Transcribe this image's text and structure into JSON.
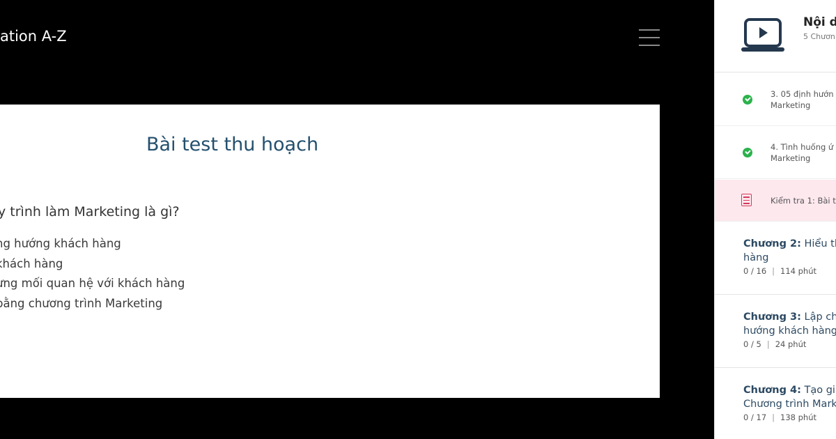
{
  "header": {
    "course_title": "ation A-Z"
  },
  "quiz": {
    "title": "Bài test thu hoạch",
    "question": "y trình làm Marketing là gì?",
    "answers": [
      "ng hướng khách hàng",
      " khách hàng",
      "ựng mối quan hệ với khách hàng",
      " bằng chương trình Marketing"
    ]
  },
  "sidebar": {
    "title": "Nội du",
    "subtitle": "5 Chươn",
    "lessons": [
      {
        "line1": "3. 05 định hướn",
        "line2": "Marketing",
        "status": "completed"
      },
      {
        "line1": "4. Tình huống ứ",
        "line2": "Marketing",
        "status": "completed"
      }
    ],
    "active_item": {
      "label": "Kiểm tra 1: Bài t"
    },
    "chapters": [
      {
        "prefix": "Chương 2:",
        "name": " Hiểu thị",
        "line2": "hàng",
        "progress": "0 / 16",
        "duration": "114 phút"
      },
      {
        "prefix": "Chương 3:",
        "name": " Lập chiế",
        "line2": "hướng khách hàng",
        "progress": "0 / 5",
        "duration": "24 phút"
      },
      {
        "prefix": "Chương 4:",
        "name": " Tạo giá ",
        "line2": "Chương trình Mark",
        "progress": "0 / 17",
        "duration": "138 phút"
      }
    ],
    "colors": {
      "check": "#2bb24c",
      "active_bg": "#fde8ee",
      "accent": "#d33a5b"
    }
  }
}
